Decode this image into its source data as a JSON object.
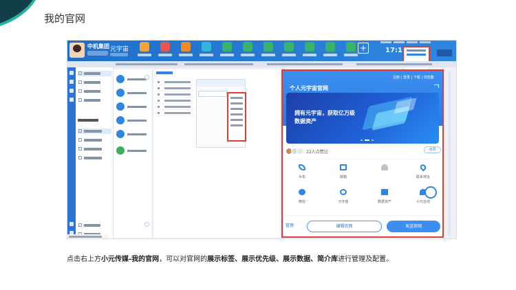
{
  "page": {
    "title": "我的官网"
  },
  "app": {
    "company": "中机集团",
    "brand": "元宇宙",
    "time": "17:12",
    "plus": "+"
  },
  "preview": {
    "header_title": "个人元宇宙官网",
    "links": "注册 | 登录 | 下载 | 浏览器",
    "banner_line1": "拥有元宇宙，获取亿万级",
    "banner_line2": "数据资产",
    "likes_text": "22人点赞过",
    "zan_label": "点赞",
    "grid": [
      {
        "label": "手机",
        "icon": "phone-icon"
      },
      {
        "label": "邮箱",
        "icon": "mail-icon"
      },
      {
        "label": "",
        "icon": "user-icon"
      },
      {
        "label": "联系地址",
        "icon": "location-icon"
      },
      {
        "label": "微信",
        "icon": "wechat-icon"
      },
      {
        "label": "元宇宙",
        "icon": "globe-icon"
      },
      {
        "label": "数据资产",
        "icon": "asset-icon"
      },
      {
        "label": "小元在线",
        "icon": "chat-icon"
      }
    ],
    "manage_label": "管理",
    "edit_button": "编辑官网",
    "send_button": "发送官网"
  },
  "caption": {
    "p1": "点击右上方",
    "b1": "小元传媒-我的官网",
    "p2": "，可以对官网的",
    "b2": "展示标签、展示优先级、展示数据、简介库",
    "p3": "进行管理及配置。"
  },
  "colors": {
    "accent": "#2f86e0",
    "highlight": "#e53935"
  }
}
